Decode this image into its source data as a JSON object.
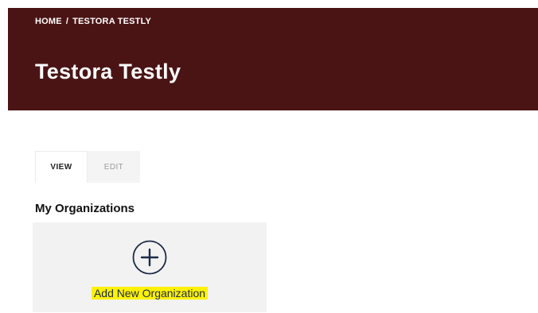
{
  "breadcrumb": {
    "home": "HOME",
    "separator": "/",
    "current": "TESTORA TESTLY"
  },
  "header": {
    "title": "Testora Testly",
    "background_color": "#4a1415"
  },
  "tabs": [
    {
      "label": "VIEW",
      "active": true
    },
    {
      "label": "EDIT",
      "active": false
    }
  ],
  "organizations": {
    "heading": "My Organizations",
    "add_card": {
      "icon": "plus-circle-icon",
      "label": "Add New Organization",
      "icon_color": "#1b2a48",
      "highlight_color": "#fff200"
    }
  }
}
